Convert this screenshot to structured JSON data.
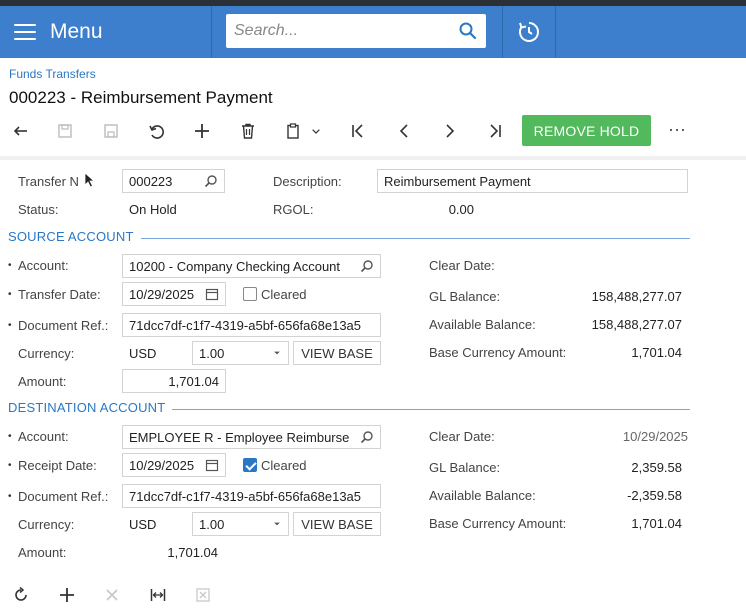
{
  "topbar": {
    "menu_label": "Menu",
    "search_placeholder": "Search..."
  },
  "page": {
    "breadcrumb": "Funds Transfers",
    "title": "000223 - Reimbursement Payment"
  },
  "toolbar": {
    "remove_hold_label": "REMOVE HOLD",
    "more_label": "···"
  },
  "header": {
    "transfer_nbr_label": "Transfer N",
    "transfer_nbr_value": "000223",
    "description_label": "Description:",
    "description_value": "Reimbursement Payment",
    "status_label": "Status:",
    "status_value": "On Hold",
    "rgol_label": "RGOL:",
    "rgol_value": "0.00"
  },
  "source": {
    "section_title": "SOURCE ACCOUNT",
    "account_label": "Account:",
    "account_value": "10200 - Company Checking Account",
    "date_label": "Transfer Date:",
    "date_value": "10/29/2025",
    "cleared_label": "Cleared",
    "cleared": false,
    "docref_label": "Document Ref.:",
    "docref_value": "71dcc7df-c1f7-4319-a5bf-656fa68e13a5",
    "currency_label": "Currency:",
    "currency_value": "USD",
    "rate_value": "1.00",
    "view_base_label": "VIEW BASE",
    "amount_label": "Amount:",
    "amount_value": "1,701.04",
    "clear_date_label": "Clear Date:",
    "clear_date_value": "",
    "gl_balance_label": "GL Balance:",
    "gl_balance_value": "158,488,277.07",
    "avail_balance_label": "Available Balance:",
    "avail_balance_value": "158,488,277.07",
    "base_amount_label": "Base Currency Amount:",
    "base_amount_value": "1,701.04"
  },
  "destination": {
    "section_title": "DESTINATION ACCOUNT",
    "account_label": "Account:",
    "account_value": "EMPLOYEE R - Employee Reimburse",
    "date_label": "Receipt Date:",
    "date_value": "10/29/2025",
    "cleared_label": "Cleared",
    "cleared": true,
    "docref_label": "Document Ref.:",
    "docref_value": "71dcc7df-c1f7-4319-a5bf-656fa68e13a5",
    "currency_label": "Currency:",
    "currency_value": "USD",
    "rate_value": "1.00",
    "view_base_label": "VIEW BASE",
    "amount_label": "Amount:",
    "amount_value": "1,701.04",
    "clear_date_label": "Clear Date:",
    "clear_date_value": "10/29/2025",
    "gl_balance_label": "GL Balance:",
    "gl_balance_value": "2,359.58",
    "avail_balance_label": "Available Balance:",
    "avail_balance_value": "-2,359.58",
    "base_amount_label": "Base Currency Amount:",
    "base_amount_value": "1,701.04"
  },
  "colors": {
    "topbar": "#3d7fcc",
    "accent": "#2a78c4",
    "remove_hold": "#52b95c"
  }
}
